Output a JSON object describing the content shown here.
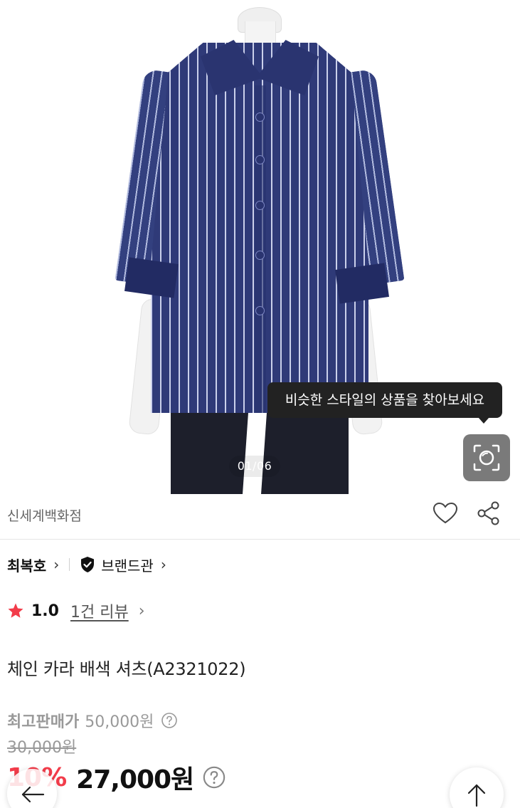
{
  "gallery": {
    "counter": "01/06",
    "similar_style_tooltip": "비슷한 스타일의 상품을 찾아보세요"
  },
  "store": {
    "name": "신세계백화점"
  },
  "brand": {
    "name": "최복호",
    "brand_hall_label": "브랜드관"
  },
  "rating": {
    "score": "1.0",
    "review_count_label": "1건 리뷰"
  },
  "product": {
    "title": "체인 카라 배색 셔츠(A2321022)"
  },
  "pricing": {
    "max_price_label": "최고판매가",
    "max_price": "50,000원",
    "original_price": "30,000원",
    "discount_rate": "10%",
    "sale_price": "27,000원"
  },
  "colors": {
    "accent_red": "#f23c4a",
    "tooltip_bg": "#222222",
    "lens_button_bg": "#7a7a7a"
  },
  "icons": {
    "lens": "camera-lens-icon",
    "wishlist": "heart-icon",
    "share": "share-icon",
    "brand_hall": "shield-check-icon",
    "rating": "star-icon",
    "help": "question-circle-icon",
    "back": "arrow-left-icon",
    "top": "arrow-up-icon"
  }
}
